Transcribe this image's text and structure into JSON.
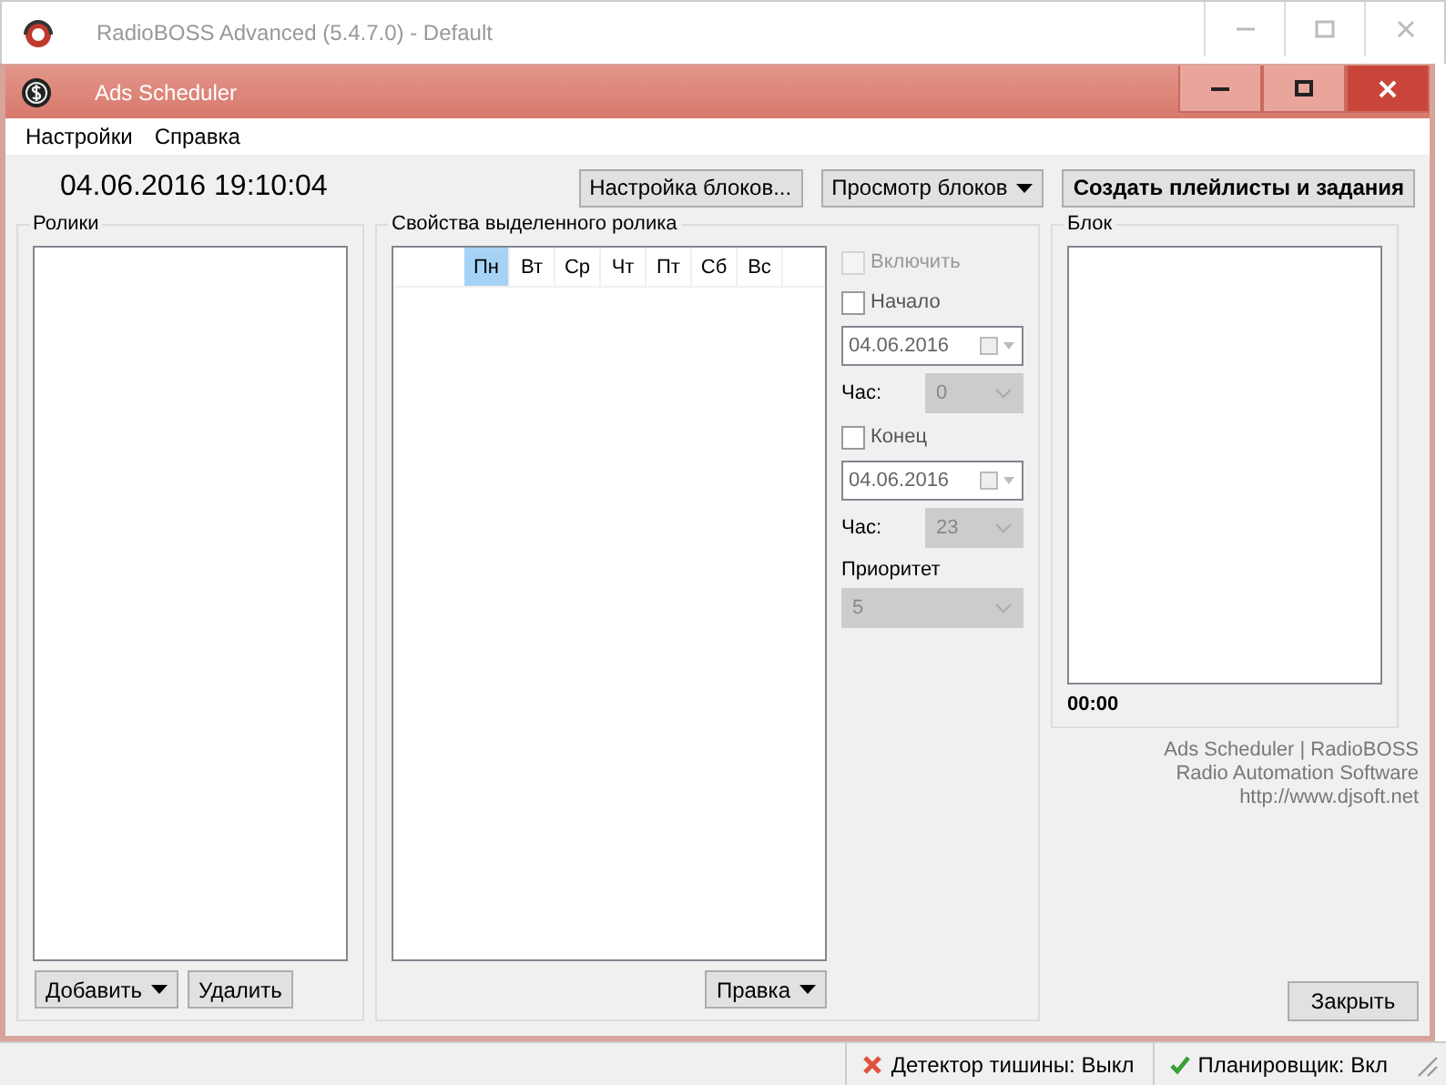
{
  "app_window": {
    "title": "RadioBOSS Advanced (5.4.7.0) - Default"
  },
  "window": {
    "title": "Ads Scheduler"
  },
  "menu": [
    "Настройки",
    "Справка"
  ],
  "clock": "04.06.2016 19:10:04",
  "toolbar": [
    {
      "label": "Настройка блоков...",
      "kind": "plain"
    },
    {
      "label": "Просмотр блоков",
      "kind": "dropdown"
    },
    {
      "label": "Создать плейлисты и задания",
      "kind": "bold"
    }
  ],
  "ads_panel": {
    "title": "Ролики",
    "buttons": [
      {
        "label": "Добавить",
        "kind": "dropdown"
      },
      {
        "label": "Удалить",
        "kind": "plain"
      }
    ]
  },
  "properties_panel": {
    "title": "Свойства выделенного ролика",
    "days": [
      {
        "label": "Пн",
        "selected": true
      },
      {
        "label": "Вт",
        "selected": false
      },
      {
        "label": "Ср",
        "selected": false
      },
      {
        "label": "Чт",
        "selected": false
      },
      {
        "label": "Пт",
        "selected": false
      },
      {
        "label": "Сб",
        "selected": false
      },
      {
        "label": "Вс",
        "selected": false
      }
    ],
    "controls": [
      {
        "kind": "checkbox",
        "label": "Включить",
        "checked": false,
        "disabled": true
      },
      {
        "kind": "checkbox",
        "label": "Начало",
        "checked": false,
        "disabled": false
      },
      {
        "kind": "date",
        "value": "04.06.2016"
      },
      {
        "kind": "combo",
        "label": "Час:",
        "value": "0",
        "disabled": true
      },
      {
        "kind": "checkbox",
        "label": "Конец",
        "checked": false,
        "disabled": false
      },
      {
        "kind": "date",
        "value": "04.06.2016"
      },
      {
        "kind": "combo",
        "label": "Час:",
        "value": "23",
        "disabled": true
      },
      {
        "kind": "heading",
        "label": "Приоритет"
      },
      {
        "kind": "combo",
        "value": "5",
        "disabled": true
      }
    ],
    "edit_button": {
      "label": "Правка",
      "kind": "dropdown"
    }
  },
  "block_panel": {
    "title": "Блок",
    "duration": "00:00"
  },
  "about": [
    "Ads Scheduler | RadioBOSS",
    "Radio Automation Software",
    "http://www.djsoft.net"
  ],
  "close_button": "Закрыть",
  "status_bar": [
    {
      "label": "Детектор тишины: Выкл",
      "on": false
    },
    {
      "label": "Планировщик: Вкл",
      "on": true
    }
  ]
}
